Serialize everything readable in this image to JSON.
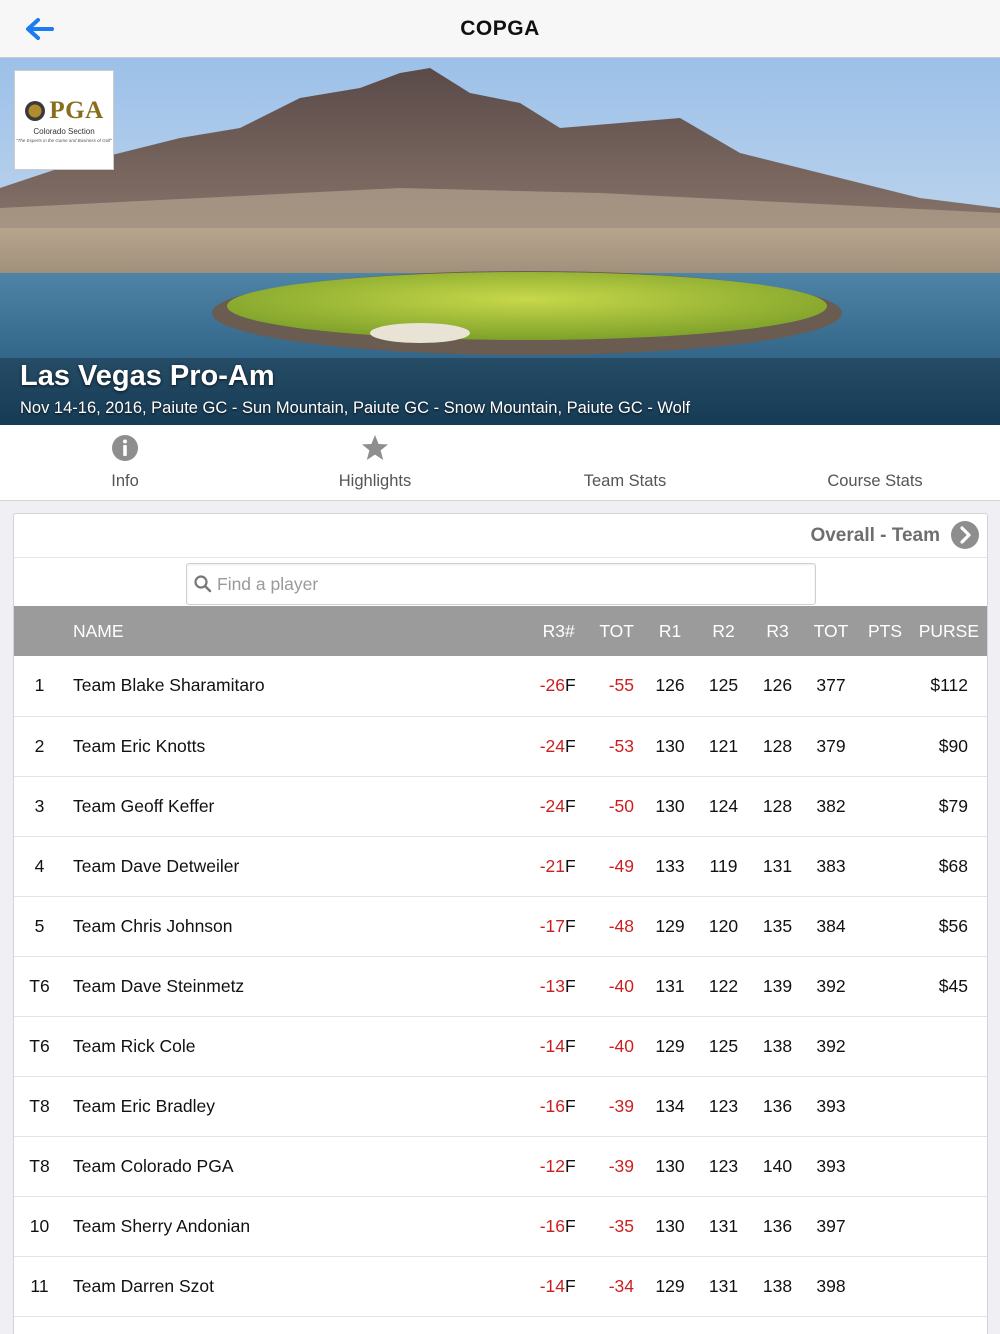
{
  "navbar": {
    "title": "COPGA",
    "back_icon": "left-arrow-icon"
  },
  "hero": {
    "logo": {
      "mark": "PGA",
      "sub": "Colorado Section",
      "tagline": "\"The Experts in the Game and Business of Golf\""
    },
    "event_title": "Las Vegas Pro-Am",
    "event_subtitle": "Nov 14-16, 2016, Paiute GC - Sun Mountain, Paiute GC - Snow Mountain, Paiute GC - Wolf"
  },
  "tabs": [
    {
      "label": "Info",
      "icon": "info-icon"
    },
    {
      "label": "Highlights",
      "icon": "star-icon"
    },
    {
      "label": "Team Stats",
      "icon": ""
    },
    {
      "label": "Course Stats",
      "icon": ""
    }
  ],
  "leaderboard": {
    "mode_label": "Overall - Team",
    "search_placeholder": "Find a player",
    "columns": [
      "",
      "NAME",
      "R3",
      "#",
      "TOT",
      "R1",
      "R2",
      "R3",
      "TOT",
      "PTS",
      "PURSE"
    ],
    "rows": [
      {
        "pos": "1",
        "name": "Team Blake Sharamitaro",
        "r3": "-26",
        "thru": "F",
        "tot_par": "-55",
        "r1": "126",
        "r2": "125",
        "r3s": "126",
        "tot": "377",
        "pts": "",
        "purse": "$112"
      },
      {
        "pos": "2",
        "name": "Team Eric Knotts",
        "r3": "-24",
        "thru": "F",
        "tot_par": "-53",
        "r1": "130",
        "r2": "121",
        "r3s": "128",
        "tot": "379",
        "pts": "",
        "purse": "$90"
      },
      {
        "pos": "3",
        "name": "Team Geoff Keffer",
        "r3": "-24",
        "thru": "F",
        "tot_par": "-50",
        "r1": "130",
        "r2": "124",
        "r3s": "128",
        "tot": "382",
        "pts": "",
        "purse": "$79"
      },
      {
        "pos": "4",
        "name": "Team Dave Detweiler",
        "r3": "-21",
        "thru": "F",
        "tot_par": "-49",
        "r1": "133",
        "r2": "119",
        "r3s": "131",
        "tot": "383",
        "pts": "",
        "purse": "$68"
      },
      {
        "pos": "5",
        "name": "Team Chris Johnson",
        "r3": "-17",
        "thru": "F",
        "tot_par": "-48",
        "r1": "129",
        "r2": "120",
        "r3s": "135",
        "tot": "384",
        "pts": "",
        "purse": "$56"
      },
      {
        "pos": "T6",
        "name": "Team Dave Steinmetz",
        "r3": "-13",
        "thru": "F",
        "tot_par": "-40",
        "r1": "131",
        "r2": "122",
        "r3s": "139",
        "tot": "392",
        "pts": "",
        "purse": "$45"
      },
      {
        "pos": "T6",
        "name": "Team Rick Cole",
        "r3": "-14",
        "thru": "F",
        "tot_par": "-40",
        "r1": "129",
        "r2": "125",
        "r3s": "138",
        "tot": "392",
        "pts": "",
        "purse": ""
      },
      {
        "pos": "T8",
        "name": "Team Eric Bradley",
        "r3": "-16",
        "thru": "F",
        "tot_par": "-39",
        "r1": "134",
        "r2": "123",
        "r3s": "136",
        "tot": "393",
        "pts": "",
        "purse": ""
      },
      {
        "pos": "T8",
        "name": "Team Colorado PGA",
        "r3": "-12",
        "thru": "F",
        "tot_par": "-39",
        "r1": "130",
        "r2": "123",
        "r3s": "140",
        "tot": "393",
        "pts": "",
        "purse": ""
      },
      {
        "pos": "10",
        "name": "Team Sherry Andonian",
        "r3": "-16",
        "thru": "F",
        "tot_par": "-35",
        "r1": "130",
        "r2": "131",
        "r3s": "136",
        "tot": "397",
        "pts": "",
        "purse": ""
      },
      {
        "pos": "11",
        "name": "Team Darren Szot",
        "r3": "-14",
        "thru": "F",
        "tot_par": "-34",
        "r1": "129",
        "r2": "131",
        "r3s": "138",
        "tot": "398",
        "pts": "",
        "purse": ""
      }
    ]
  },
  "colors": {
    "accent": "#1a7cf0",
    "negative": "#cc1f1f",
    "header_bg": "#9b9b9b"
  }
}
